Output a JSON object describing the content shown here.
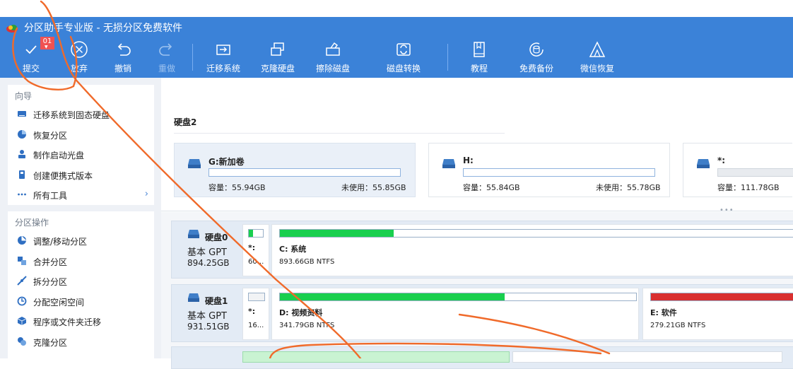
{
  "app": {
    "title": "分区助手专业版 - 无损分区免费软件"
  },
  "toolbar": {
    "pending_badge": "01",
    "items": [
      {
        "icon": "check-icon",
        "label": "提交"
      },
      {
        "icon": "cancel-circle-icon",
        "label": "放弃"
      },
      {
        "icon": "undo-icon",
        "label": "撤销"
      },
      {
        "icon": "redo-icon",
        "label": "重做",
        "disabled": true
      },
      {
        "icon": "migrate-os-icon",
        "label": "迁移系统"
      },
      {
        "icon": "clone-disk-icon",
        "label": "克隆硬盘"
      },
      {
        "icon": "wipe-disk-icon",
        "label": "擦除磁盘"
      },
      {
        "icon": "disk-convert-icon",
        "label": "磁盘转换"
      },
      {
        "icon": "tutorial-book-icon",
        "label": "教程"
      },
      {
        "icon": "free-backup-icon",
        "label": "免费备份"
      },
      {
        "icon": "wechat-recovery-icon",
        "label": "微信恢复"
      }
    ]
  },
  "sidebar": {
    "wizard": {
      "title": "向导",
      "items": [
        {
          "icon": "migrate-ssd-icon",
          "label": "迁移系统到固态硬盘"
        },
        {
          "icon": "recover-partition-icon",
          "label": "恢复分区"
        },
        {
          "icon": "boot-disc-icon",
          "label": "制作启动光盘"
        },
        {
          "icon": "portable-version-icon",
          "label": "创建便携式版本"
        },
        {
          "icon": "more-dots-icon",
          "label": "所有工具",
          "arrow": "›"
        }
      ]
    },
    "operations": {
      "title": "分区操作",
      "items": [
        {
          "icon": "resize-move-icon",
          "label": "调整/移动分区"
        },
        {
          "icon": "merge-partition-icon",
          "label": "合并分区"
        },
        {
          "icon": "split-partition-icon",
          "label": "拆分分区"
        },
        {
          "icon": "allocate-space-icon",
          "label": "分配空闲空间"
        },
        {
          "icon": "app-migrate-icon",
          "label": "程序或文件夹迁移"
        },
        {
          "icon": "clone-partition-icon",
          "label": "克隆分区"
        }
      ]
    }
  },
  "disk2_view": {
    "title": "硬盘2",
    "partitions": [
      {
        "name": "G:新加卷",
        "capacity": "容量：55.94GB",
        "free": "未使用：55.85GB",
        "used_fraction": 0.0,
        "selected": true
      },
      {
        "name": "H:",
        "capacity": "容量：55.84GB",
        "free": "未使用：55.78GB",
        "used_fraction": 0.0
      },
      {
        "name": "*:",
        "capacity": "容量：111.78GB",
        "free": "",
        "used_fraction": 0.0
      }
    ]
  },
  "disks": [
    {
      "name": "硬盘0",
      "type": "基本 GPT",
      "size": "894.25GB",
      "partitions": [
        {
          "label": "*:",
          "detail": "60...",
          "used_fraction": 0.3
        },
        {
          "label": "C: 系统",
          "detail": "893.66GB NTFS",
          "used_fraction": 0.22
        }
      ]
    },
    {
      "name": "硬盘1",
      "type": "基本 GPT",
      "size": "931.51GB",
      "partitions": [
        {
          "label": "*:",
          "detail": "16...",
          "used_fraction": 0.0
        },
        {
          "label": "D: 视频资料",
          "detail": "341.79GB NTFS",
          "used_fraction": 0.63
        },
        {
          "label": "E: 软件",
          "detail": "279.21GB NTFS",
          "used_fraction": 1.0
        }
      ]
    }
  ],
  "colors": {
    "accent": "#3b82d8",
    "used_green": "#19cf4e",
    "used_red": "#d93030",
    "annotation_orange": "#f06a2a"
  }
}
